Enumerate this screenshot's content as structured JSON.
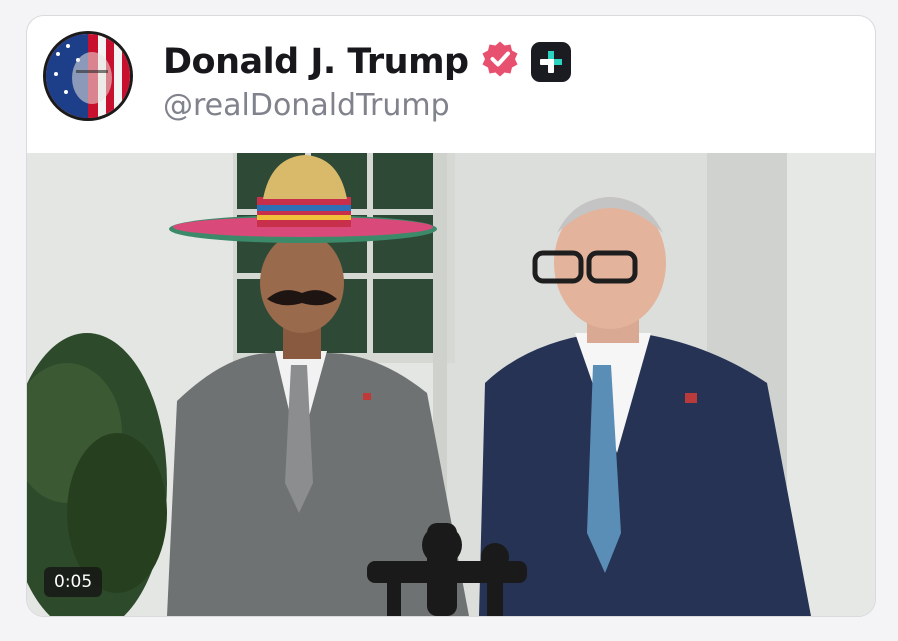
{
  "post": {
    "author": {
      "display_name": "Donald J. Trump",
      "handle": "@realDonaldTrump",
      "verified_icon": "verified-badge-icon",
      "extra_icon": "plus-badge-icon"
    },
    "media": {
      "type": "video",
      "timestamp": "0:05"
    }
  },
  "colors": {
    "verified_badge": "#e8506f",
    "plus_badge_bg": "#1b1c22",
    "plus_badge_fg": "#2bd4c0",
    "name_text": "#17171c",
    "handle_text": "#80828c"
  }
}
